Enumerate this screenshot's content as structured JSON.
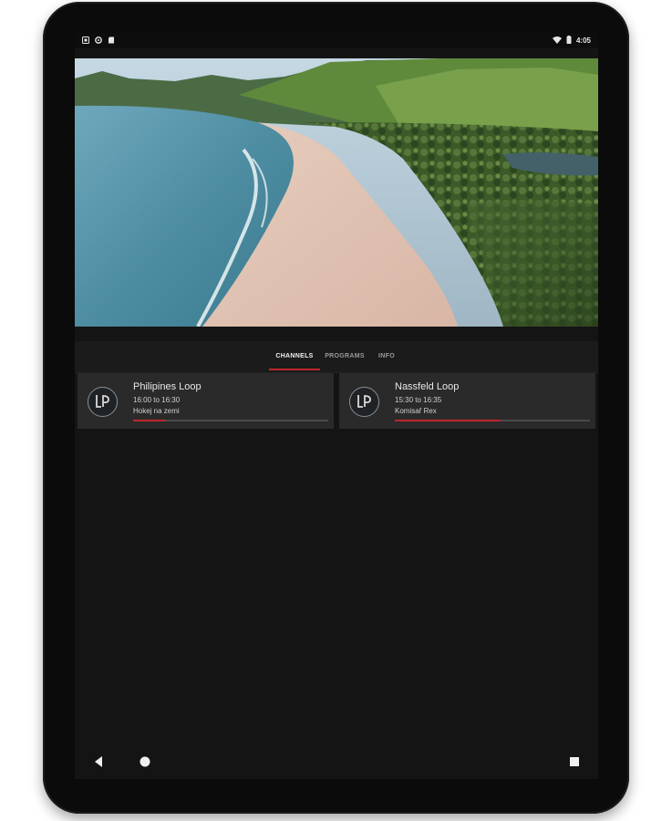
{
  "status_bar": {
    "time": "4:05",
    "left_icons": [
      "notification-icon",
      "settings-status-icon",
      "sd-card-icon"
    ],
    "right_icons": [
      "wifi-icon",
      "battery-icon"
    ]
  },
  "video": {
    "description_icon": "video-player"
  },
  "tabs": [
    {
      "label": "CHANNELS",
      "active": true
    },
    {
      "label": "PROGRAMS",
      "active": false
    },
    {
      "label": "INFO",
      "active": false
    }
  ],
  "channels": [
    {
      "title": "Philipines Loop",
      "time": "16:00 to 16:30",
      "program": "Hokej na zemi",
      "progress": 0.17
    },
    {
      "title": "Nassfeld Loop",
      "time": "15:30 to 16:35",
      "program": "Komisař Rex",
      "progress": 0.54
    }
  ],
  "nav": {
    "icons": [
      "back-icon",
      "home-icon",
      "recents-icon"
    ]
  },
  "colors": {
    "accent": "#c0262d",
    "background": "#141414",
    "card": "#2a2a2a"
  }
}
